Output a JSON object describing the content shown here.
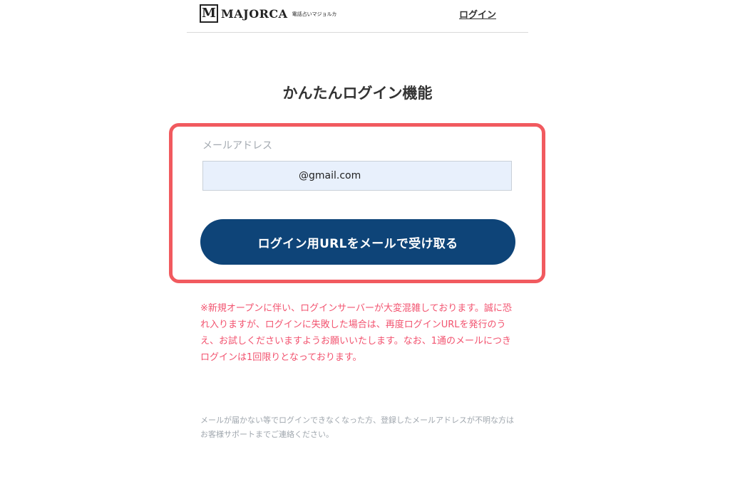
{
  "header": {
    "logo_mark": "M",
    "logo_text": "MAJORCA",
    "logo_sub": "電話占いマジョルカ",
    "login_link": "ログイン"
  },
  "main": {
    "title": "かんたんログイン機能",
    "email_label": "メールアドレス",
    "email_value": "@gmail.com",
    "submit_label": "ログイン用URLをメールで受け取る",
    "notice": "※新規オープンに伴い、ログインサーバーが大変混雑しております。誠に恐れ入りますが、ログインに失敗した場合は、再度ログインURLを発行のうえ、お試しくださいますようお願いいたします。なお、1通のメールにつきログインは1回限りとなっております。",
    "help": "メールが届かない等でログインできなくなった方、登録したメールアドレスが不明な方はお客様サポートまでご連絡ください。"
  },
  "colors": {
    "highlight_border": "#f15a5f",
    "button_bg": "#0e4478",
    "input_bg": "#e8f0fc",
    "notice_text": "#f2536f",
    "help_text": "#a0a7ae"
  }
}
